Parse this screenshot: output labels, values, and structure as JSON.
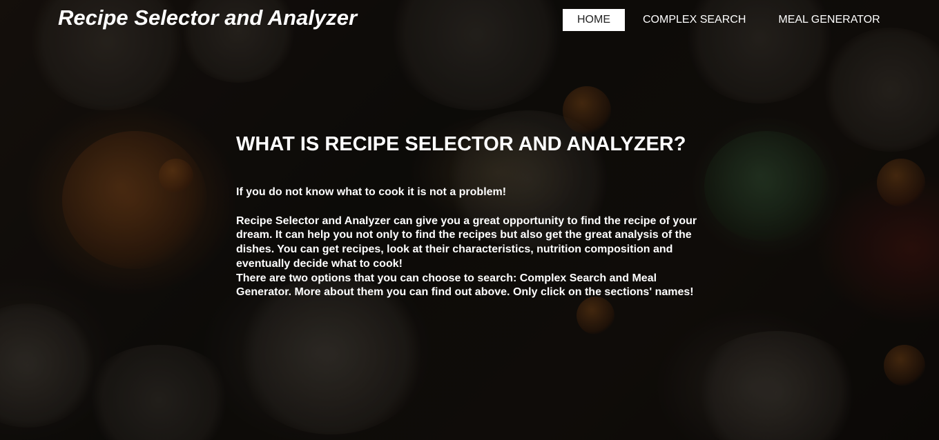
{
  "header": {
    "title": "Recipe Selector and Analyzer"
  },
  "nav": {
    "items": [
      {
        "label": "HOME",
        "active": true
      },
      {
        "label": "COMPLEX SEARCH",
        "active": false
      },
      {
        "label": "MEAL GENERATOR",
        "active": false
      }
    ]
  },
  "main": {
    "heading": "WHAT IS RECIPE SELECTOR AND ANALYZER?",
    "intro": "If you do not know what to cook it is not a problem!",
    "paragraph_1": "Recipe Selector and Analyzer can give you a great opportunity to find the recipe of your dream. It can help you not only to find the recipes but also get the great analysis of the dishes. You can get recipes, look at their characteristics, nutrition composition and eventually decide what to cook!",
    "paragraph_2": "There are two options that you can choose to search: Complex Search and Meal Generator. More about them you can find out above. Only click on the sections' names!"
  },
  "colors": {
    "overlay": "#000000",
    "text": "#ffffff",
    "active_nav_bg": "#ffffff",
    "active_nav_text": "#222222"
  }
}
